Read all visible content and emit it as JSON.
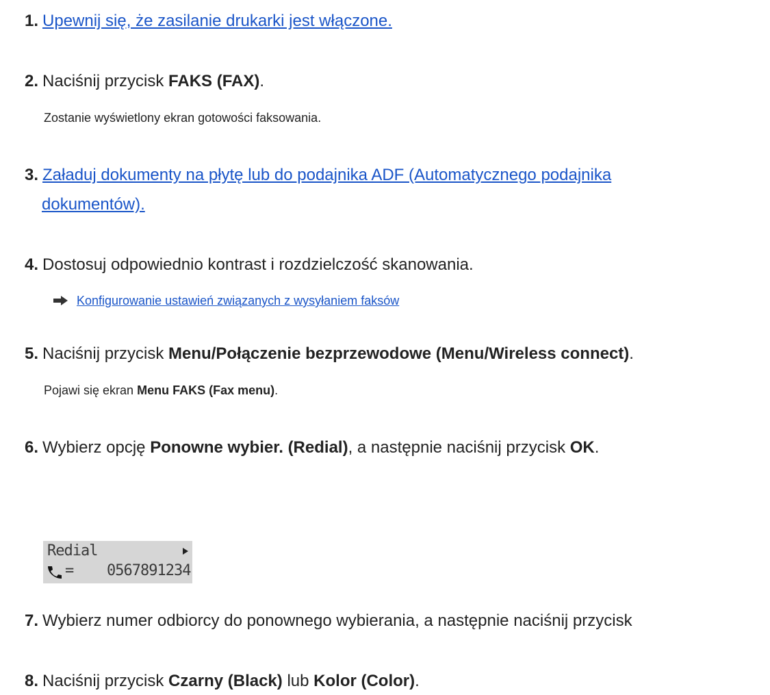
{
  "steps": [
    {
      "num": "1.",
      "link": "Upewnij się, że zasilanie drukarki jest włączone."
    },
    {
      "num": "2.",
      "pre": "Naciśnij przycisk ",
      "bold": "FAKS (FAX)",
      "post": ".",
      "note": "Zostanie wyświetlony ekran gotowości faksowania."
    },
    {
      "num": "3.",
      "link_line1": "Załaduj dokumenty na płytę lub do podajnika ADF (Automatycznego podajnika",
      "link_line2": "dokumentów)."
    },
    {
      "num": "4.",
      "text": "Dostosuj odpowiednio kontrast i rozdzielczość skanowania.",
      "sublink": "Konfigurowanie ustawień związanych z wysyłaniem faksów"
    },
    {
      "num": "5.",
      "pre": "Naciśnij przycisk ",
      "bold": "Menu/Połączenie bezprzewodowe (Menu/Wireless connect)",
      "post": ".",
      "note_pre": "Pojawi się ekran ",
      "note_bold": "Menu FAKS (Fax menu)",
      "note_post": "."
    },
    {
      "num": "6.",
      "pre": "Wybierz opcję ",
      "bold": "Ponowne wybier. (Redial)",
      "mid": ", a następnie naciśnij przycisk ",
      "bold2": "OK",
      "post": "."
    },
    {
      "num": "7.",
      "text": "Wybierz numer odbiorcy do ponownego wybierania, a następnie naciśnij przycisk"
    },
    {
      "num": "8.",
      "pre": "Naciśnij przycisk ",
      "bold": "Czarny (Black)",
      "mid": " lub ",
      "bold2": "Kolor (Color)",
      "post": "."
    }
  ],
  "lcd": {
    "title": "Redial",
    "equals": "=",
    "number": "0567891234",
    "icons": [
      "arrow-right-icon",
      "phone-icon",
      "more-arrow-icon"
    ]
  },
  "colors": {
    "link": "#1a55c8",
    "text": "#222222",
    "lcd_bg": "#d6d6d6"
  }
}
